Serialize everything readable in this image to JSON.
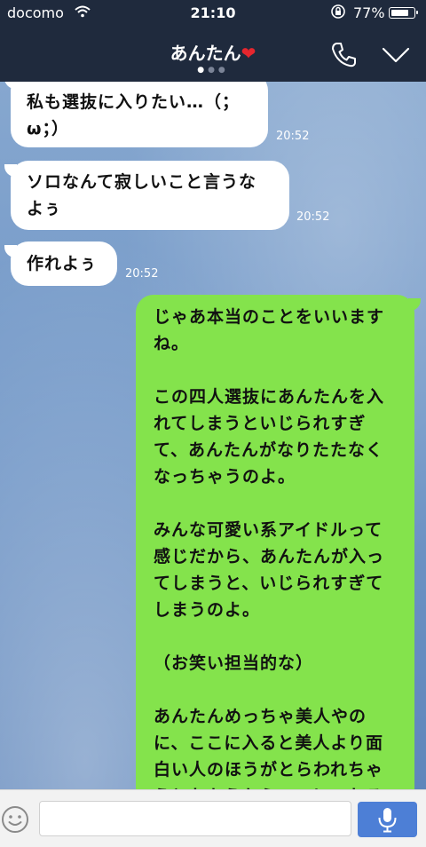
{
  "status_bar": {
    "carrier": "docomo",
    "time": "21:10",
    "battery_percent": "77%",
    "battery_level": 0.77
  },
  "header": {
    "contact_name": "あんたん",
    "heart": "❤",
    "page_dots": {
      "count": 3,
      "active_index": 0
    },
    "call_icon": "phone-icon",
    "collapse_icon": "chevron-down-icon"
  },
  "messages": [
    {
      "direction": "incoming",
      "text": "私も選抜に入りたい…（；\nω；）",
      "time": "20:52"
    },
    {
      "direction": "incoming",
      "text": "ソロなんて寂しいこと言うな\nよぅ",
      "time": "20:52"
    },
    {
      "direction": "incoming",
      "text": "作れよぅ",
      "time": "20:52"
    },
    {
      "direction": "outgoing",
      "text": "じゃあ本当のことをいいます\nね。\n\nこの四人選抜にあんたんを入\nれてしまうといじられすぎ\nて、あんたんがなりたたなく\nなっちゃうのよ。\n\nみんな可愛い系アイドルって\n感じだから、あんたんが入っ\nてしまうと、いじられすぎて\nしまうのよ。\n\n（お笑い担当的な）\n\nあんたんめっちゃ美人やの\nに、ここに入ると美人より面\n白い人のほうがとらわれちゃ\nうとおもうからここにいれる\nより、"
    }
  ],
  "input_bar": {
    "emoji_icon": "smiley-icon",
    "message_placeholder": "",
    "mic_icon": "microphone-icon"
  },
  "colors": {
    "header_bg": "#1f2a3d",
    "outgoing_bubble": "#84e34c",
    "incoming_bubble": "#ffffff",
    "mic_button": "#4d7fd6",
    "heart": "#e5262e"
  }
}
